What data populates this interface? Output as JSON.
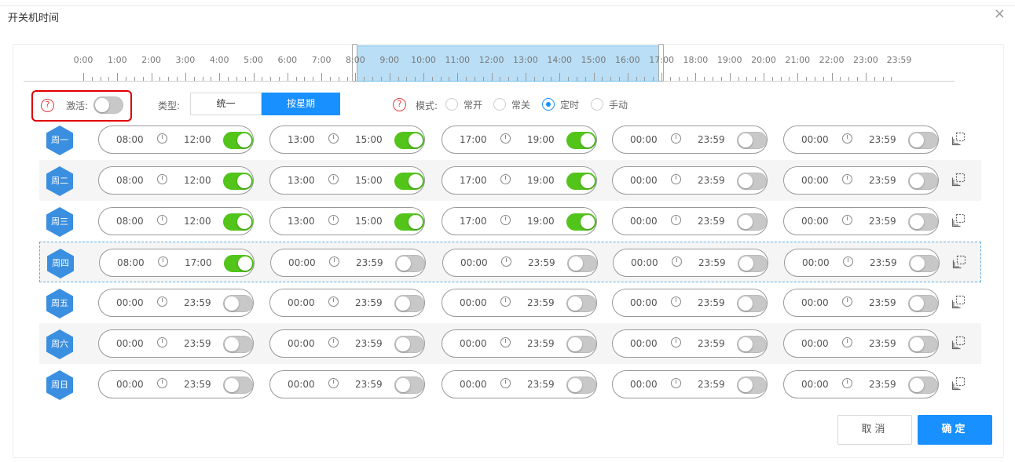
{
  "dialog": {
    "title": "开关机时间",
    "close_glyph": "×"
  },
  "timeline": {
    "labels": [
      "0:00",
      "1:00",
      "2:00",
      "3:00",
      "4:00",
      "5:00",
      "6:00",
      "7:00",
      "8:00",
      "9:00",
      "10:00",
      "11:00",
      "12:00",
      "13:00",
      "14:00",
      "15:00",
      "16:00",
      "17:00",
      "18:00",
      "19:00",
      "20:00",
      "21:00",
      "22:00",
      "23:00",
      "23:59"
    ],
    "selection": {
      "start": "8:00",
      "end": "17:00"
    }
  },
  "controls": {
    "activate_label": "激活:",
    "activate_on": false,
    "type_label": "类型:",
    "type_options": [
      "统一",
      "按星期"
    ],
    "type_selected": "按星期",
    "mode_label": "模式:",
    "modes": [
      {
        "label": "常开",
        "checked": false
      },
      {
        "label": "常关",
        "checked": false
      },
      {
        "label": "定时",
        "checked": true
      },
      {
        "label": "手动",
        "checked": false
      }
    ],
    "help_glyph": "?"
  },
  "days": [
    {
      "label": "周一",
      "slots": [
        [
          "08:00",
          "12:00",
          true
        ],
        [
          "13:00",
          "15:00",
          true
        ],
        [
          "17:00",
          "19:00",
          true
        ],
        [
          "00:00",
          "23:59",
          false
        ],
        [
          "00:00",
          "23:59",
          false
        ]
      ]
    },
    {
      "label": "周二",
      "slots": [
        [
          "08:00",
          "12:00",
          true
        ],
        [
          "13:00",
          "15:00",
          true
        ],
        [
          "17:00",
          "19:00",
          true
        ],
        [
          "00:00",
          "23:59",
          false
        ],
        [
          "00:00",
          "23:59",
          false
        ]
      ]
    },
    {
      "label": "周三",
      "slots": [
        [
          "08:00",
          "12:00",
          true
        ],
        [
          "13:00",
          "15:00",
          true
        ],
        [
          "17:00",
          "19:00",
          true
        ],
        [
          "00:00",
          "23:59",
          false
        ],
        [
          "00:00",
          "23:59",
          false
        ]
      ]
    },
    {
      "label": "周四",
      "slots": [
        [
          "08:00",
          "17:00",
          true
        ],
        [
          "00:00",
          "23:59",
          false
        ],
        [
          "00:00",
          "23:59",
          false
        ],
        [
          "00:00",
          "23:59",
          false
        ],
        [
          "00:00",
          "23:59",
          false
        ]
      ]
    },
    {
      "label": "周五",
      "slots": [
        [
          "00:00",
          "23:59",
          false
        ],
        [
          "00:00",
          "23:59",
          false
        ],
        [
          "00:00",
          "23:59",
          false
        ],
        [
          "00:00",
          "23:59",
          false
        ],
        [
          "00:00",
          "23:59",
          false
        ]
      ]
    },
    {
      "label": "周六",
      "slots": [
        [
          "00:00",
          "23:59",
          false
        ],
        [
          "00:00",
          "23:59",
          false
        ],
        [
          "00:00",
          "23:59",
          false
        ],
        [
          "00:00",
          "23:59",
          false
        ],
        [
          "00:00",
          "23:59",
          false
        ]
      ]
    },
    {
      "label": "周日",
      "slots": [
        [
          "00:00",
          "23:59",
          false
        ],
        [
          "00:00",
          "23:59",
          false
        ],
        [
          "00:00",
          "23:59",
          false
        ],
        [
          "00:00",
          "23:59",
          false
        ],
        [
          "00:00",
          "23:59",
          false
        ]
      ]
    }
  ],
  "buttons": {
    "cancel": "取消",
    "ok": "确定"
  },
  "colors": {
    "accent": "#1890ff",
    "switch_on": "#52c41a",
    "selection": "#b9def5",
    "highlight": "#e00000"
  }
}
